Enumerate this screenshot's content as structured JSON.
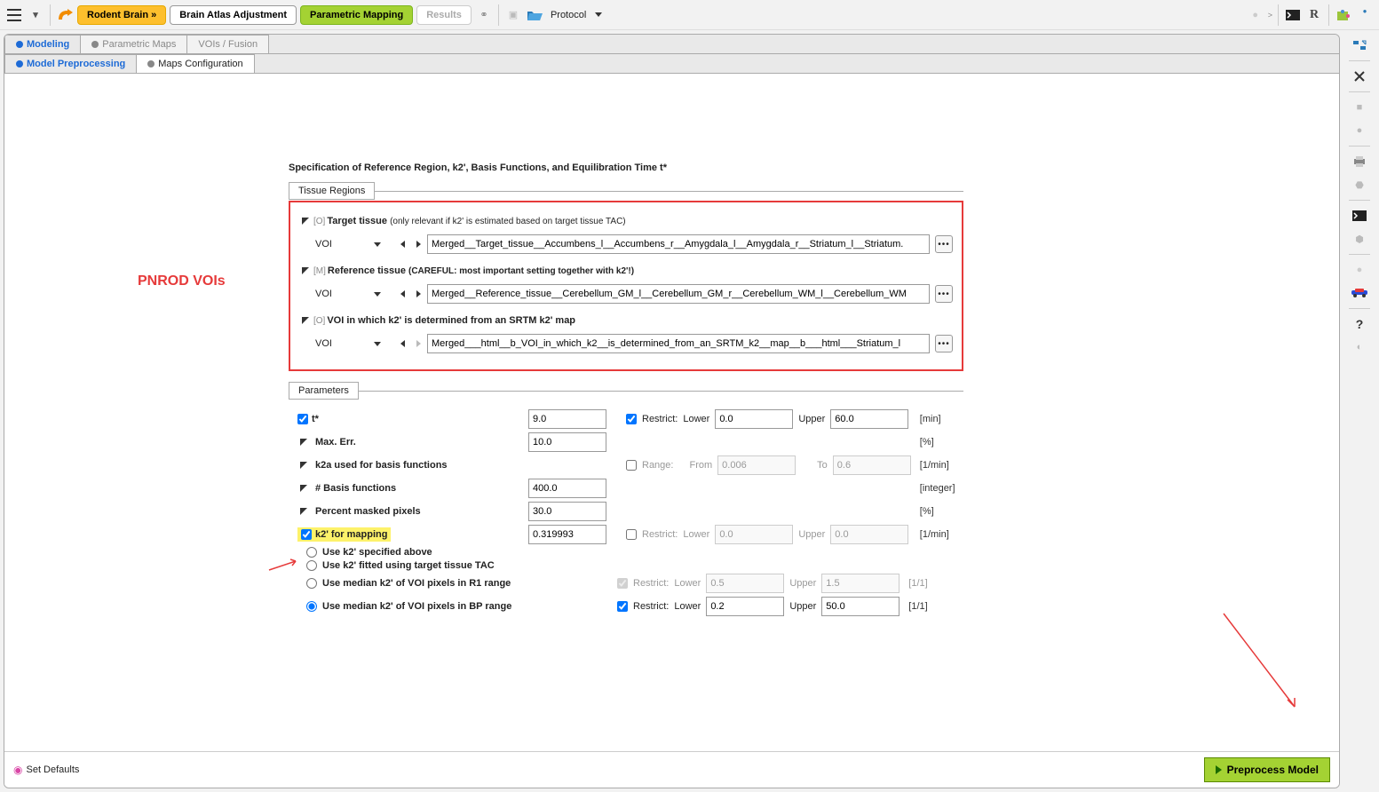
{
  "toolbar": {
    "rodent_brain": "Rodent Brain »",
    "brain_atlas": "Brain Atlas Adjustment",
    "parametric_mapping": "Parametric Mapping",
    "results": "Results",
    "protocol": "Protocol",
    "r_letter": "R",
    "chevron": ">"
  },
  "top_tabs": {
    "modeling": "Modeling",
    "parametric_maps": "Parametric Maps",
    "vois_fusion": "VOIs / Fusion"
  },
  "sub_tabs": {
    "model_preprocessing": "Model Preprocessing",
    "maps_configuration": "Maps Configuration"
  },
  "annotation": "PNROD VOIs",
  "content": {
    "title": "Specification of Reference Region, k2', Basis Functions, and Equilibration Time t*",
    "tissue_regions_label": "Tissue Regions",
    "parameters_label": "Parameters",
    "voi_label": "VOI",
    "target_tissue": {
      "tag": "[O]",
      "label": "Target tissue",
      "note": "(only relevant if k2' is estimated based on target tissue TAC)",
      "value": "Merged__Target_tissue__Accumbens_l__Accumbens_r__Amygdala_l__Amygdala_r__Striatum_l__Striatum."
    },
    "reference_tissue": {
      "tag": "[M]",
      "label": "Reference tissue",
      "note": "(CAREFUL: most important setting together with k2'!)",
      "value": "Merged__Reference_tissue__Cerebellum_GM_l__Cerebellum_GM_r__Cerebellum_WM_l__Cerebellum_WM"
    },
    "voi_k2": {
      "tag": "[O]",
      "label": "VOI in which k2' is determined from an SRTM k2' map",
      "value": "Merged___html__b_VOI_in_which_k2__is_determined_from_an_SRTM_k2__map__b___html___Striatum_l"
    },
    "params": {
      "t_star": {
        "label": "t*",
        "value": "9.0",
        "restrict": true,
        "restrict_label": "Restrict:",
        "lower_label": "Lower",
        "lower": "0.0",
        "upper_label": "Upper",
        "upper": "60.0",
        "unit": "[min]"
      },
      "max_err": {
        "label": "Max. Err.",
        "value": "10.0",
        "unit": "[%]"
      },
      "k2a": {
        "label": "k2a used for basis functions",
        "range_label": "Range:",
        "from_label": "From",
        "from": "0.006",
        "to_label": "To",
        "to": "0.6",
        "unit": "[1/min]"
      },
      "basis": {
        "label": "# Basis functions",
        "value": "400.0",
        "unit": "[integer]"
      },
      "masked": {
        "label": "Percent masked pixels",
        "value": "30.0",
        "unit": "[%]"
      },
      "k2map": {
        "label": "k2' for mapping",
        "value": "0.319993",
        "restrict_label": "Restrict:",
        "lower_label": "Lower",
        "lower": "0.0",
        "upper_label": "Upper",
        "upper": "0.0",
        "unit": "[1/min]"
      },
      "radios": {
        "r1": "Use k2' specified above",
        "r2": "Use k2' fitted using target tissue TAC",
        "r3": {
          "label": "Use median k2' of VOI pixels in R1 range",
          "restrict_label": "Restrict:",
          "lower_label": "Lower",
          "lower": "0.5",
          "upper_label": "Upper",
          "upper": "1.5",
          "unit": "[1/1]"
        },
        "r4": {
          "label": "Use median k2' of VOI pixels in BP range",
          "restrict_label": "Restrict:",
          "lower_label": "Lower",
          "lower": "0.2",
          "upper_label": "Upper",
          "upper": "50.0",
          "unit": "[1/1]"
        }
      }
    }
  },
  "bottom": {
    "set_defaults": "Set Defaults",
    "preprocess": "Preprocess Model"
  }
}
